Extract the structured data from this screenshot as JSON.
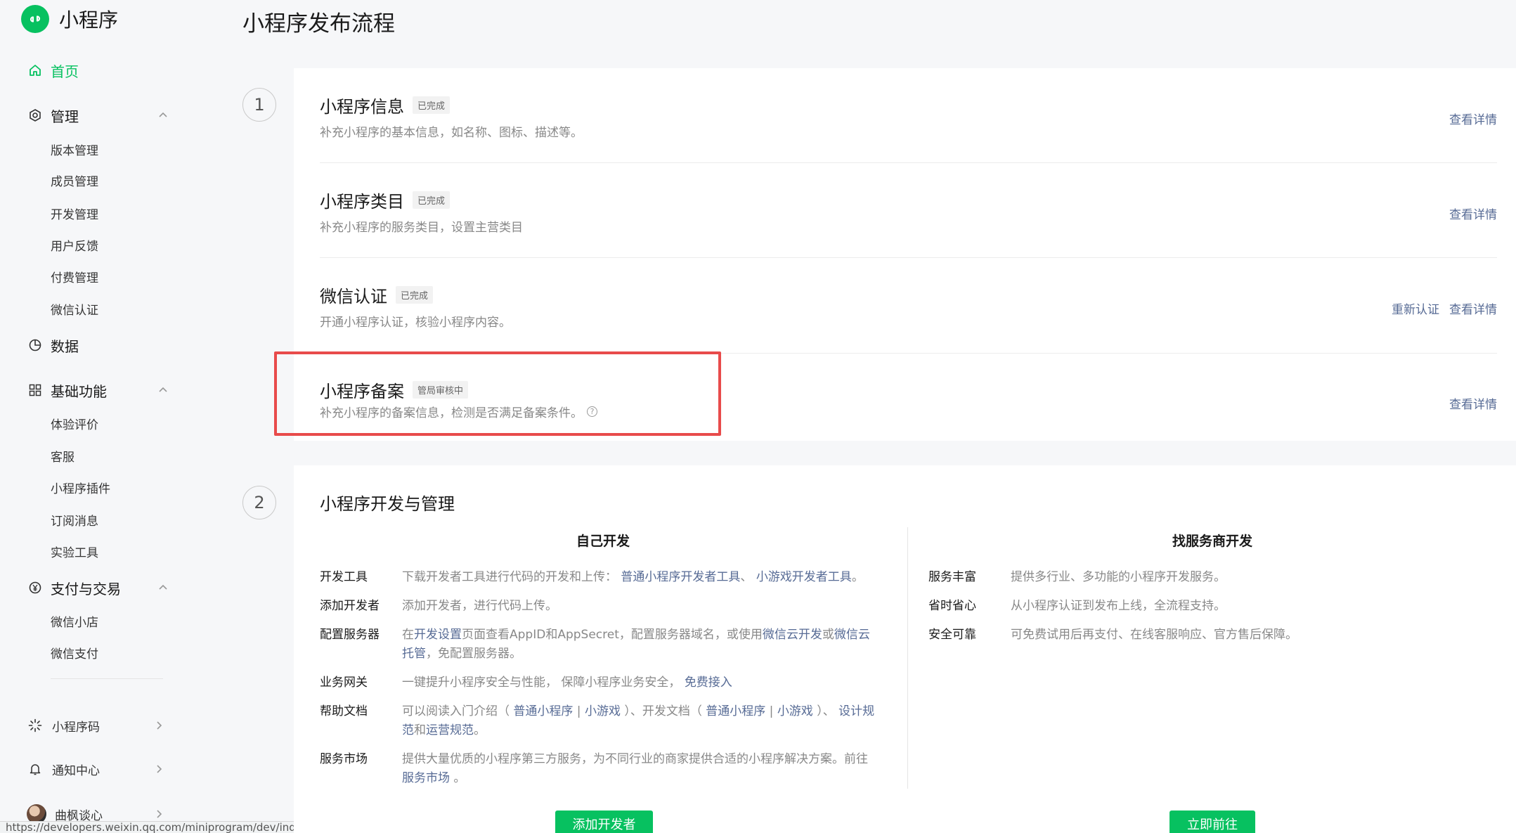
{
  "app": {
    "logo_text": "小程序"
  },
  "sidebar": {
    "home": "首页",
    "manage": {
      "label": "管理",
      "items": [
        "版本管理",
        "成员管理",
        "开发管理",
        "用户反馈",
        "付费管理",
        "微信认证"
      ]
    },
    "data": "数据",
    "basic": {
      "label": "基础功能",
      "items": [
        "体验评价",
        "客服",
        "小程序插件",
        "订阅消息",
        "实验工具"
      ]
    },
    "pay": {
      "label": "支付与交易",
      "items": [
        "微信小店",
        "微信支付"
      ]
    },
    "bottom": {
      "qrcode": "小程序码",
      "notify": "通知中心",
      "user": "曲枫谈心"
    }
  },
  "status_url": "https://developers.weixin.qq.com/miniprogram/dev/index.html",
  "main": {
    "title": "小程序发布流程",
    "steps": [
      "1",
      "2"
    ],
    "rows": [
      {
        "title": "小程序信息",
        "badge": "已完成",
        "desc": "补充小程序的基本信息，如名称、图标、描述等。",
        "actions": [
          "查看详情"
        ]
      },
      {
        "title": "小程序类目",
        "badge": "已完成",
        "desc": "补充小程序的服务类目，设置主营类目",
        "actions": [
          "查看详情"
        ]
      },
      {
        "title": "微信认证",
        "badge": "已完成",
        "desc": "开通小程序认证，核验小程序内容。",
        "actions": [
          "重新认证",
          "查看详情"
        ]
      },
      {
        "title": "小程序备案",
        "badge": "管局审核中",
        "desc": "补充小程序的备案信息，检测是否满足备案条件。",
        "actions": [
          "查看详情"
        ]
      }
    ],
    "dev": {
      "title": "小程序开发与管理",
      "self": {
        "head": "自己开发",
        "items": [
          {
            "k": "开发工具",
            "parts": [
              [
                "t",
                "下载开发者工具进行代码的开发和上传： "
              ],
              [
                "l",
                "普通小程序开发者工具"
              ],
              [
                "t",
                "、 "
              ],
              [
                "l",
                "小游戏开发者工具"
              ],
              [
                "t",
                "。"
              ]
            ]
          },
          {
            "k": "添加开发者",
            "parts": [
              [
                "t",
                "添加开发者，进行代码上传。"
              ]
            ]
          },
          {
            "k": "配置服务器",
            "parts": [
              [
                "t",
                "在"
              ],
              [
                "l",
                "开发设置"
              ],
              [
                "t",
                "页面查看AppID和AppSecret，配置服务器域名，或使用"
              ],
              [
                "l",
                "微信云开发"
              ],
              [
                "t",
                "或"
              ],
              [
                "l",
                "微信云托管"
              ],
              [
                "t",
                "，免配置服务器。"
              ]
            ]
          },
          {
            "k": "业务网关",
            "parts": [
              [
                "t",
                "一键提升小程序安全与性能， 保障小程序业务安全， "
              ],
              [
                "l",
                "免费接入"
              ]
            ]
          },
          {
            "k": "帮助文档",
            "parts": [
              [
                "t",
                "可以阅读入门介绍（ "
              ],
              [
                "l",
                "普通小程序"
              ],
              [
                "t",
                " | "
              ],
              [
                "l",
                "小游戏"
              ],
              [
                "t",
                " ）、开发文档（ "
              ],
              [
                "l",
                "普通小程序"
              ],
              [
                "t",
                " | "
              ],
              [
                "l",
                "小游戏"
              ],
              [
                "t",
                " ）、 "
              ],
              [
                "l",
                "设计规范"
              ],
              [
                "t",
                "和"
              ],
              [
                "l",
                "运营规范"
              ],
              [
                "t",
                "。"
              ]
            ]
          },
          {
            "k": "服务市场",
            "parts": [
              [
                "t",
                "提供大量优质的小程序第三方服务，为不同行业的商家提供合适的小程序解决方案。前往 "
              ],
              [
                "l",
                "服务市场"
              ],
              [
                "t",
                " 。"
              ]
            ]
          }
        ],
        "button": "添加开发者"
      },
      "vendor": {
        "head": "找服务商开发",
        "items": [
          {
            "k": "服务丰富",
            "parts": [
              [
                "t",
                "提供多行业、多功能的小程序开发服务。"
              ]
            ]
          },
          {
            "k": "省时省心",
            "parts": [
              [
                "t",
                "从小程序认证到发布上线，全流程支持。"
              ]
            ]
          },
          {
            "k": "安全可靠",
            "parts": [
              [
                "t",
                "可免费试用后再支付、在线客服响应、官方售后保障。"
              ]
            ]
          }
        ],
        "button": "立即前往"
      }
    }
  },
  "colors": {
    "brand": "#07c160",
    "link": "#576b95",
    "highlight": "#e84b4b"
  }
}
